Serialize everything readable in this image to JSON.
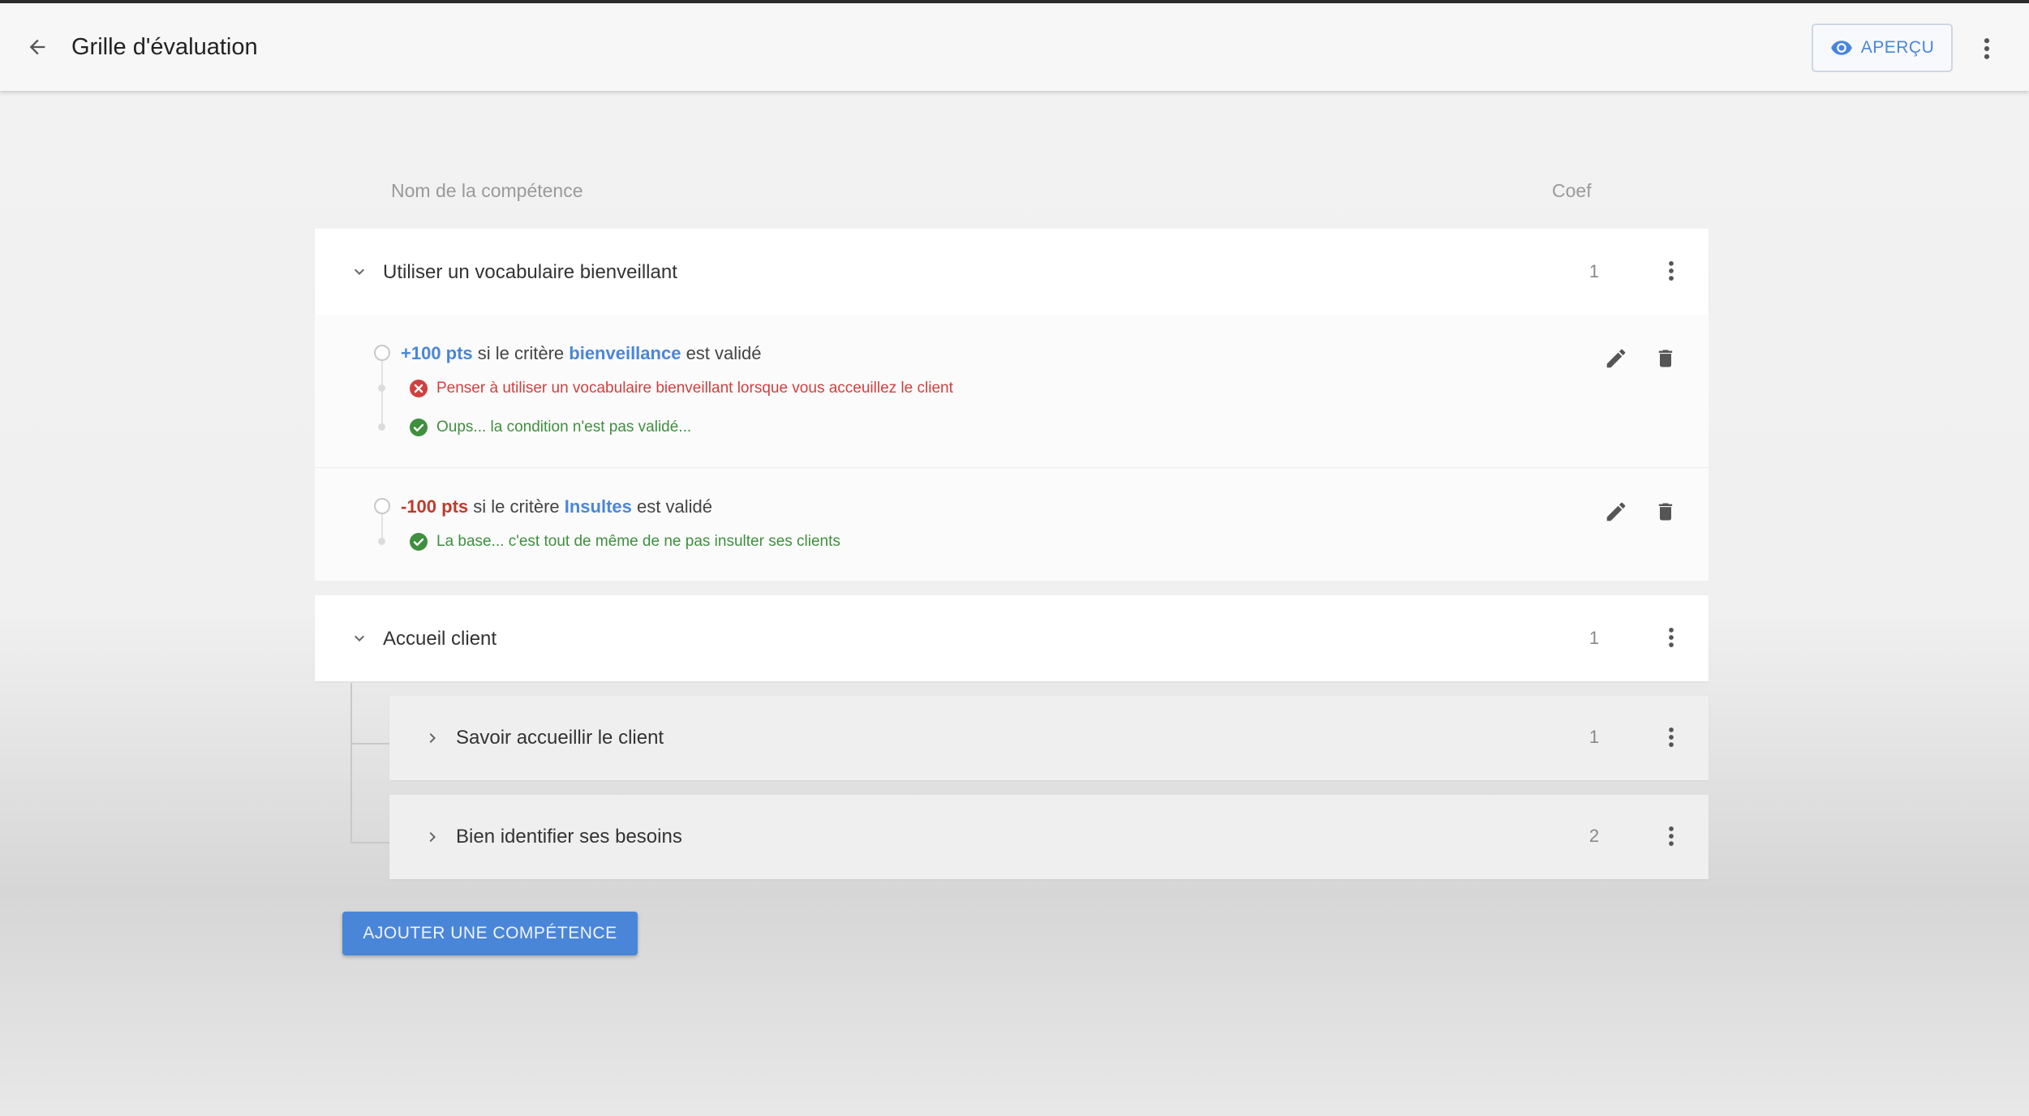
{
  "header": {
    "title": "Grille d'évaluation",
    "apercu_label": "APERÇU"
  },
  "columns": {
    "name": "Nom de la compétence",
    "coef": "Coef"
  },
  "competences": [
    {
      "name": "Utiliser un vocabulaire bienveillant",
      "coef": "1",
      "criteria": [
        {
          "points": "+100 pts",
          "prefix": " si le critère ",
          "criterion": "bienveillance",
          "suffix": " est validé",
          "feedback": [
            {
              "type": "error",
              "text": "Penser à utiliser un vocabulaire bienveillant lorsque vous acceuillez le client"
            },
            {
              "type": "success",
              "text": "Oups... la condition n'est pas validé..."
            }
          ]
        },
        {
          "points": "-100 pts",
          "prefix": " si le critère ",
          "criterion": "Insultes",
          "suffix": " est validé",
          "feedback": [
            {
              "type": "success",
              "text": "La base... c'est tout de même de ne pas insulter ses clients"
            }
          ]
        }
      ]
    },
    {
      "name": "Accueil client",
      "coef": "1",
      "children": [
        {
          "name": "Savoir accueillir le client",
          "coef": "1"
        },
        {
          "name": "Bien identifier ses besoins",
          "coef": "2"
        }
      ]
    }
  ],
  "add_button_label": "AJOUTER UNE COMPÉTENCE",
  "colors": {
    "accent": "#4a86d8",
    "negative": "#c0392b",
    "error": "#d04040",
    "success": "#3f8f3f"
  },
  "icons": [
    "arrow-left-icon",
    "eye-icon",
    "more-vert-icon",
    "chevron-down-icon",
    "chevron-right-icon",
    "pencil-icon",
    "trash-icon",
    "error-circle-icon",
    "check-circle-icon"
  ]
}
